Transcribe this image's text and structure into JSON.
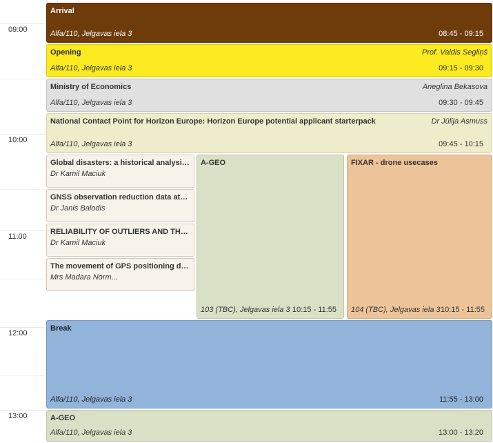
{
  "timeline": {
    "hours": [
      "09:00",
      "10:00",
      "11:00",
      "12:00",
      "13:00"
    ]
  },
  "events": {
    "arrival": {
      "title": "Arrival",
      "room": "Alfa/110, Jelgavas iela 3",
      "time": "08:45 - 09:15",
      "color": "#6e3b0b"
    },
    "opening": {
      "title": "Opening",
      "speaker": "Prof. Valdis Segliņš",
      "room": "Alfa/110, Jelgavas iela 3",
      "time": "09:15 - 09:30",
      "color": "#fbea1f"
    },
    "ministry": {
      "title": "Ministry of Economics",
      "speaker": "Aneglina Bekasova",
      "room": "Alfa/110, Jelgavas iela 3",
      "time": "09:30 - 09:45",
      "color": "#e0e0e0"
    },
    "ncp": {
      "title": "National Contact Point for Horizon Europe: Horizon Europe potential applicant starterpack",
      "speaker": "Dr Jūlija Asmuss",
      "room": "Alfa/110, Jelgavas iela 3",
      "time": "09:45 - 10:15",
      "color": "#efeccb"
    },
    "talk1": {
      "title": "Global disasters: a historical analysis of ...",
      "speaker": "Dr Kamil Maciuk",
      "color": "#f8f3ea"
    },
    "talk2": {
      "title": "GNSS observation reduction data at the ...",
      "speaker": "Dr Janis Balodis",
      "color": "#f8f3ea"
    },
    "talk3": {
      "title": "RELIABILITY OF OUTLIERS AND THE ...",
      "speaker": "Dr Kamil Maciuk",
      "color": "#f8f3ea"
    },
    "talk4": {
      "title": "The movement of GPS positioning during ...",
      "speaker": "Mrs Madara Norm...",
      "color": "#f8f3ea"
    },
    "ageo": {
      "title": "A-GEO",
      "room": "103 (TBC), Jelgavas iela 3",
      "time": "10:15 - 11:55",
      "color": "#dae0c6"
    },
    "fixar": {
      "title": "FIXAR - drone usecases",
      "room": "104 (TBC), Jelgavas iela 3",
      "time": "10:15 - 11:55",
      "color": "#edc49a"
    },
    "break": {
      "title": "Break",
      "room": "Alfa/110, Jelgavas iela 3",
      "time": "11:55 - 13:00",
      "color": "#93b4da"
    },
    "ageo2": {
      "title": "A-GEO",
      "room": "Alfa/110, Jelgavas iela 3",
      "time": "13:00 - 13:20",
      "color": "#dae0c6"
    }
  }
}
